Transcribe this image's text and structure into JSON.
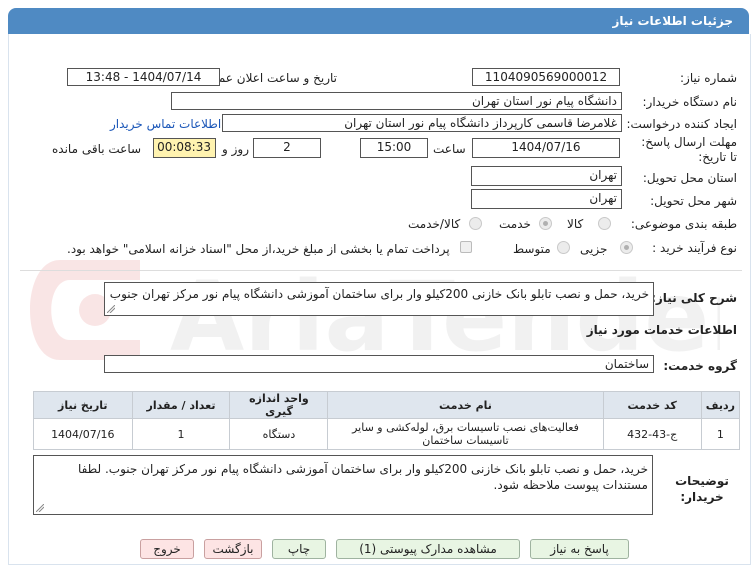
{
  "header": {
    "title": "جزئیات اطلاعات نیاز"
  },
  "form": {
    "need_number_label": "شماره نیاز:",
    "need_number": "1104090569000012",
    "announce_label": "تاریخ و ساعت اعلان عمومی:",
    "announce_value": "1404/07/14 - 13:48",
    "buyer_org_label": "نام دستگاه خریدار:",
    "buyer_org": "دانشگاه پیام نور استان تهران",
    "creator_label": "ایجاد کننده درخواست:",
    "creator": "غلامرضا قاسمی کارپرداز دانشگاه پیام نور استان تهران",
    "contact_link": "اطلاعات تماس خریدار",
    "deadline_label": "مهلت ارسال پاسخ: تا تاریخ:",
    "deadline_date": "1404/07/16",
    "time_label": "ساعت",
    "deadline_time": "15:00",
    "days_value": "2",
    "days_label": "روز و",
    "remaining_time": "00:08:33",
    "remaining_label": "ساعت باقی مانده",
    "province_label": "استان محل تحویل:",
    "province": "تهران",
    "city_label": "شهر محل تحویل:",
    "city": "تهران",
    "category_label": "طبقه بندی موضوعی:",
    "category_options": [
      "کالا",
      "خدمت",
      "کالا/خدمت"
    ],
    "category_selected": "خدمت",
    "process_label": "نوع فرآیند خرید :",
    "process_options": [
      "جزیی",
      "متوسط"
    ],
    "process_selected": "جزیی",
    "treasury_note": "پرداخت تمام یا بخشی از مبلغ خرید،از محل \"اسناد خزانه اسلامی\" خواهد بود."
  },
  "description": {
    "label": "شرح کلی نیاز:",
    "value": "خرید، حمل و نصب تابلو بانک خازنی 200کیلو وار برای ساختمان آموزشی دانشگاه پیام نور مرکز تهران جنوب"
  },
  "services": {
    "section_title": "اطلاعات خدمات مورد نیاز",
    "group_label": "گروه خدمت:",
    "group_value": "ساختمان",
    "table": {
      "headers": [
        "ردیف",
        "کد خدمت",
        "نام خدمت",
        "واحد اندازه گیری",
        "تعداد / مقدار",
        "تاریخ نیاز"
      ],
      "rows": [
        [
          "1",
          "ج-43-432",
          "فعالیت‌های نصب تاسیسات برق، لوله‌کشی و سایر تاسیسات ساختمان",
          "دستگاه",
          "1",
          "1404/07/16"
        ]
      ]
    }
  },
  "buyer_notes": {
    "label": "توضیحات خریدار:",
    "value": "خرید، حمل و نصب تابلو بانک خازنی 200کیلو وار برای ساختمان آموزشی دانشگاه پیام نور مرکز تهران جنوب. لطفا مستندات پیوست ملاحظه شود."
  },
  "buttons": {
    "reply": "پاسخ به نیاز",
    "attachments": "مشاهده مدارک پیوستی (1)",
    "print": "چاپ",
    "back": "بازگشت",
    "exit": "خروج"
  },
  "colors": {
    "header_bg": "#4f8ac3",
    "table_header_bg": "#dfe6ee",
    "button_bg": "#e8f5e3",
    "remaining_bg": "#fff3b0"
  }
}
